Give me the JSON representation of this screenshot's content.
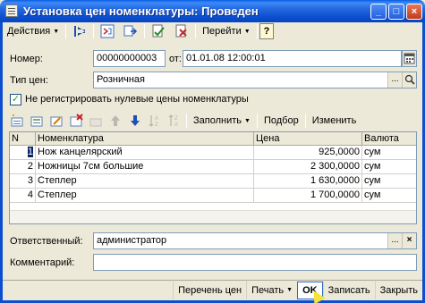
{
  "window": {
    "title": "Установка цен номенклатуры: Проведен"
  },
  "toolbar": {
    "actions_label": "Действия",
    "goto_label": "Перейти",
    "help_label": "?"
  },
  "form": {
    "number_label": "Номер:",
    "number_value": "00000000003",
    "from_label": "от:",
    "date_value": "01.01.08 12:00:01",
    "price_type_label": "Тип цен:",
    "price_type_value": "Розничная",
    "skip_zero_label": "Не регистрировать нулевые цены номенклатуры",
    "skip_zero_checked": true
  },
  "table_toolbar": {
    "fill_label": "Заполнить",
    "selection_label": "Подбор",
    "change_label": "Изменить"
  },
  "table": {
    "columns": [
      "N",
      "Номенклатура",
      "Цена",
      "Валюта"
    ],
    "rows": [
      {
        "n": "1",
        "name": "Нож канцелярский",
        "price": "925,0000",
        "currency": "сум"
      },
      {
        "n": "2",
        "name": "Ножницы 7см большие",
        "price": "2 300,0000",
        "currency": "сум"
      },
      {
        "n": "3",
        "name": "Степлер",
        "price": "1 630,0000",
        "currency": "сум"
      },
      {
        "n": "4",
        "name": "Степлер",
        "price": "1 700,0000",
        "currency": "сум"
      }
    ]
  },
  "footer_fields": {
    "responsible_label": "Ответственный:",
    "responsible_value": "администратор",
    "comment_label": "Комментарий:",
    "comment_value": ""
  },
  "bottom_bar": {
    "price_list_label": "Перечень цен",
    "print_label": "Печать",
    "ok_label": "OK",
    "save_label": "Записать",
    "close_label": "Закрыть"
  }
}
